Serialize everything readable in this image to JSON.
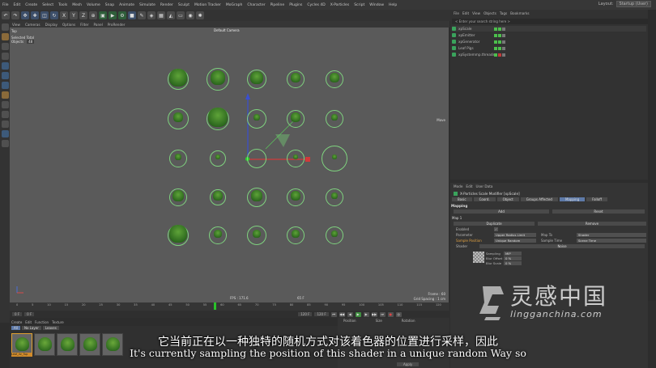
{
  "menubar": {
    "items": [
      "File",
      "Edit",
      "Create",
      "Select",
      "Tools",
      "Mesh",
      "Volume",
      "Snap",
      "Animate",
      "Simulate",
      "Render",
      "Sculpt",
      "Motion Tracker",
      "MoGraph",
      "Character",
      "Pipeline",
      "Plugins",
      "Cycles 4D",
      "X-Particles",
      "Script",
      "Window",
      "Help"
    ],
    "layout_label": "Layout:",
    "layout_value": "Startup (User)"
  },
  "viewport": {
    "menu": [
      "View",
      "Cameras",
      "Display",
      "Options",
      "Filter",
      "Panel",
      "ProRender"
    ],
    "view_name": "Top",
    "selected_total": "Selected Total",
    "objects_label": "Objects",
    "objects_value": "48",
    "camera": "Default Camera",
    "move_label": "Move",
    "fps": "FPS : 171.6",
    "frame": "Frame : 60",
    "grid_spacing": "Grid Spacing : 1 cm",
    "zoom": "65 F"
  },
  "timeline": {
    "ticks": [
      "0",
      "5",
      "10",
      "15",
      "20",
      "25",
      "30",
      "35",
      "40",
      "45",
      "50",
      "55",
      "60",
      "65",
      "70",
      "75",
      "80",
      "85",
      "90",
      "95",
      "100",
      "105",
      "110",
      "115",
      "120"
    ],
    "start": "0 F",
    "current": "0 F",
    "end": "120 F",
    "end2": "120 F"
  },
  "materials": {
    "menu": [
      "Create",
      "Edit",
      "Function",
      "Texture"
    ],
    "tabs": [
      "All",
      "No Layer",
      "Leaves"
    ],
    "selected_label": "Leaf_ilv_Tup"
  },
  "coords": {
    "headers": [
      "Position",
      "Size",
      "Rotation"
    ],
    "apply": "Apply"
  },
  "object_manager": {
    "menu": [
      "File",
      "Edit",
      "View",
      "Objects",
      "Tags",
      "Bookmarks"
    ],
    "search_placeholder": "< Enter your search string here >",
    "objects": [
      "xpScale",
      "xpEmitter",
      "xpGenerator",
      "Leaf Pigs",
      "xpSystemmp.threads"
    ]
  },
  "attributes": {
    "menu": [
      "Mode",
      "Edit",
      "User Data"
    ],
    "title": "X-Particles Scale Modifier [xpScale]",
    "tabs": [
      "Basic",
      "Coord.",
      "Object",
      "Groups Affected",
      "Mapping",
      "Falloff"
    ],
    "section": "Mapping",
    "add": "Add",
    "reset": "Reset",
    "map_header": "Map 1",
    "duplicate": "Duplicate",
    "remove": "Remove",
    "enabled_label": "Enabled",
    "parameter_label": "Parameter",
    "parameter_value": "Upper Radius Limit",
    "map_to_label": "Map To",
    "map_to_value": "Shader",
    "sample_position_label": "Sample Position",
    "sample_position_value": "Unique Random",
    "sample_time_label": "Sample Time",
    "sample_time_value": "Scene Time",
    "shader_label": "Shader",
    "shader_value": "Noise",
    "sampling_label": "Sampling",
    "sampling_value": "MIP",
    "blur_offset_label": "Blur Offset",
    "blur_offset_value": "0 %",
    "blur_scale_label": "Blur Scale",
    "blur_scale_value": "0 %"
  },
  "subtitle": {
    "cn": "它当前正在以一种独特的随机方式对该着色器的位置进行采样，因此",
    "en": "It's currently sampling the position of this shader in a unique random Way so"
  },
  "watermark": {
    "cn": "灵感中国",
    "en": "lingganchina.com"
  }
}
